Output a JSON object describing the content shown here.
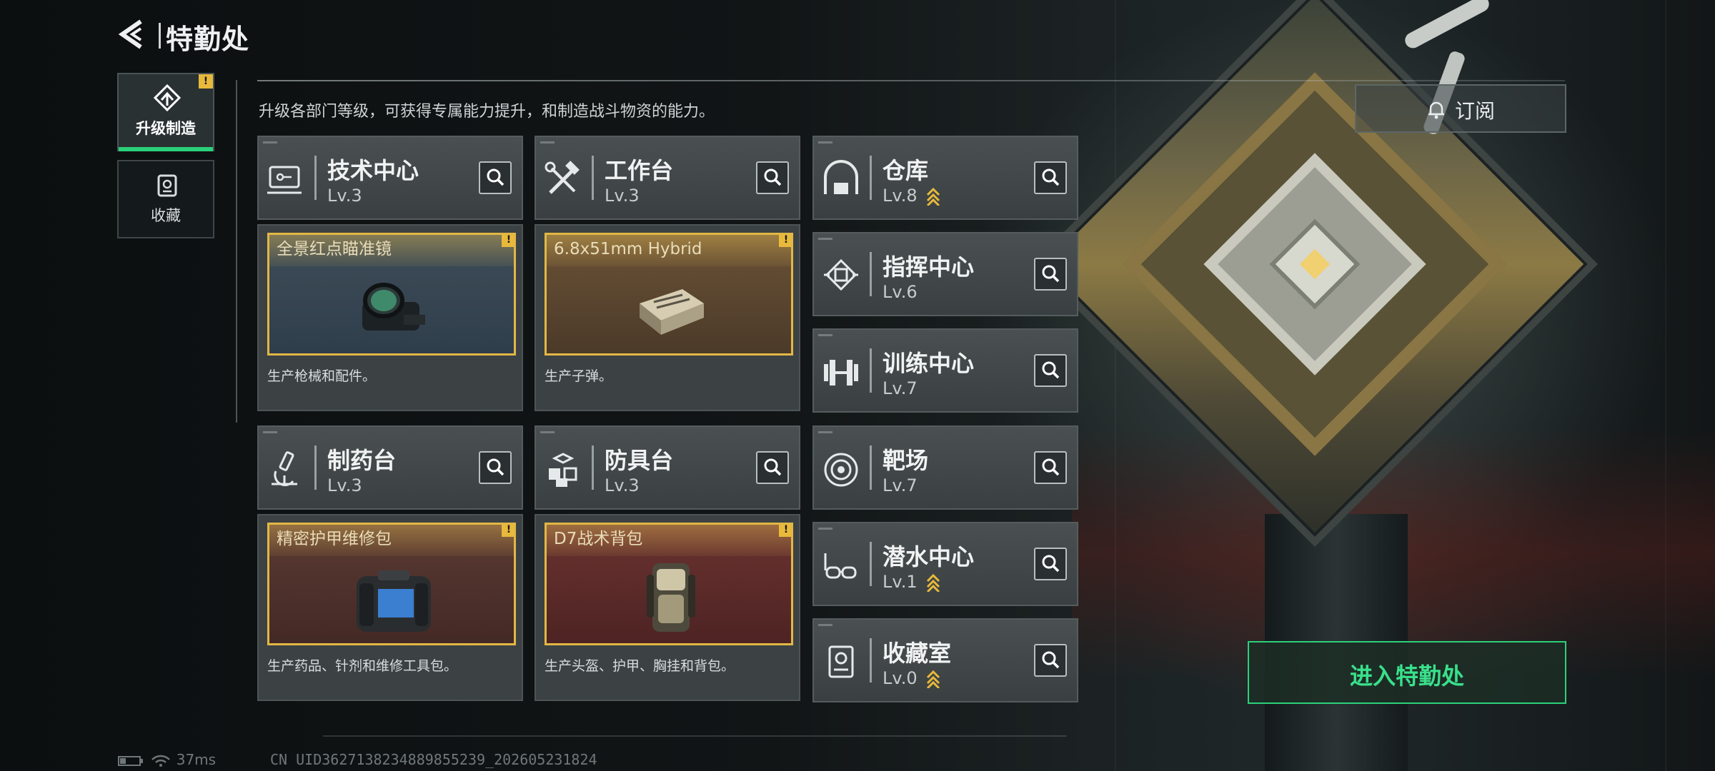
{
  "header": {
    "title": "特勤处",
    "description": "升级各部门等级，可获得专属能力提升，和制造战斗物资的能力。"
  },
  "tabs": [
    {
      "label": "升级制造",
      "active": true,
      "badge": "!"
    },
    {
      "label": "收藏",
      "active": false
    }
  ],
  "facilities_left": [
    {
      "name": "技术中心",
      "level": "Lv.3",
      "icon": "monitor-icon"
    },
    {
      "name": "工作台",
      "level": "Lv.3",
      "icon": "hammer-wrench-icon"
    },
    {
      "name": "制药台",
      "level": "Lv.3",
      "icon": "microscope-icon"
    },
    {
      "name": "防具台",
      "level": "Lv.3",
      "icon": "blocks-icon"
    }
  ],
  "productions": [
    {
      "item": "全景红点瞄准镜",
      "desc": "生产枪械和配件。",
      "badge": "!"
    },
    {
      "item": "6.8x51mm Hybrid",
      "desc": "生产子弹。",
      "badge": "!"
    },
    {
      "item": "精密护甲维修包",
      "desc": "生产药品、针剂和维修工具包。",
      "badge": "!"
    },
    {
      "item": "D7战术背包",
      "desc": "生产头盔、护甲、胸挂和背包。",
      "badge": "!"
    }
  ],
  "facilities_right": [
    {
      "name": "仓库",
      "level": "Lv.8",
      "upgradable": true,
      "icon": "warehouse-icon"
    },
    {
      "name": "指挥中心",
      "level": "Lv.6",
      "upgradable": false,
      "icon": "chip-icon"
    },
    {
      "name": "训练中心",
      "level": "Lv.7",
      "upgradable": false,
      "icon": "dumbbell-icon"
    },
    {
      "name": "靶场",
      "level": "Lv.7",
      "upgradable": false,
      "icon": "target-icon"
    },
    {
      "name": "潜水中心",
      "level": "Lv.1",
      "upgradable": true,
      "icon": "goggles-icon"
    },
    {
      "name": "收藏室",
      "level": "Lv.0",
      "upgradable": true,
      "icon": "trophy-icon"
    }
  ],
  "buttons": {
    "subscribe": "订阅",
    "enter": "进入特勤处"
  },
  "status": {
    "ping": "37ms",
    "uid": "CN UID3627138234889855239_202605231824"
  },
  "colors": {
    "accent_green": "#2bd17a",
    "badge_yellow": "#e8b93b",
    "gold_border": "#e2b745"
  }
}
